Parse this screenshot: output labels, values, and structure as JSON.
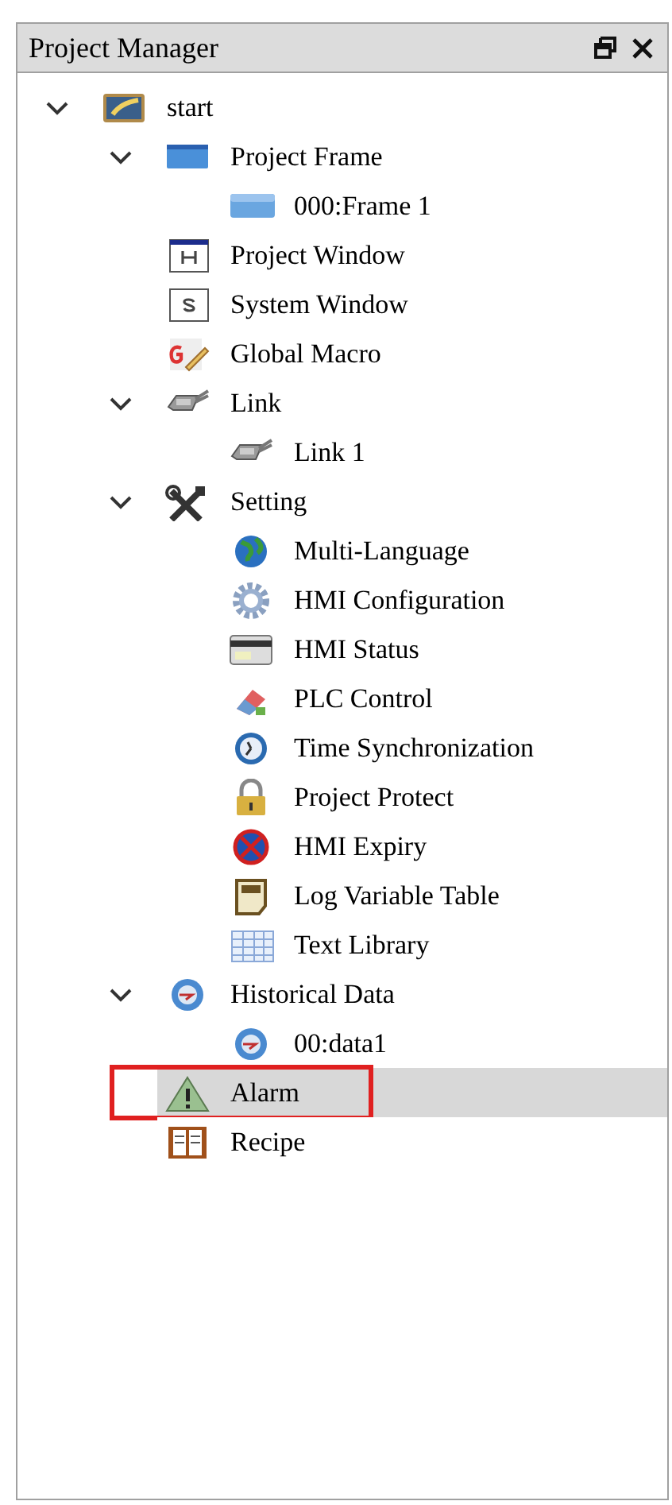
{
  "panel": {
    "title": "Project Manager"
  },
  "tree": [
    {
      "label": "start",
      "kind": "project",
      "expanded": true,
      "selected": false,
      "outlined": false,
      "children": [
        {
          "label": "Project Frame",
          "kind": "frame",
          "expanded": true,
          "selected": false,
          "outlined": false,
          "children": [
            {
              "label": "000:Frame 1",
              "kind": "screen",
              "selected": false,
              "outlined": false
            }
          ]
        },
        {
          "label": "Project Window",
          "kind": "window-h",
          "selected": false,
          "outlined": false
        },
        {
          "label": "System Window",
          "kind": "window-s",
          "selected": false,
          "outlined": false
        },
        {
          "label": "Global Macro",
          "kind": "macro",
          "selected": false,
          "outlined": false
        },
        {
          "label": "Link",
          "kind": "connector",
          "expanded": true,
          "selected": false,
          "outlined": false,
          "children": [
            {
              "label": "Link 1",
              "kind": "connector",
              "selected": false,
              "outlined": false
            }
          ]
        },
        {
          "label": "Setting",
          "kind": "tools",
          "expanded": true,
          "selected": false,
          "outlined": false,
          "children": [
            {
              "label": "Multi-Language",
              "kind": "globe",
              "selected": false,
              "outlined": false
            },
            {
              "label": "HMI Configuration",
              "kind": "gear",
              "selected": false,
              "outlined": false
            },
            {
              "label": "HMI Status",
              "kind": "card",
              "selected": false,
              "outlined": false
            },
            {
              "label": "PLC Control",
              "kind": "eraser",
              "selected": false,
              "outlined": false
            },
            {
              "label": "Time Synchronization",
              "kind": "clock",
              "selected": false,
              "outlined": false
            },
            {
              "label": "Project Protect",
              "kind": "lock",
              "selected": false,
              "outlined": false
            },
            {
              "label": "HMI Expiry",
              "kind": "forbidden",
              "selected": false,
              "outlined": false
            },
            {
              "label": "Log Variable Table",
              "kind": "var",
              "selected": false,
              "outlined": false
            },
            {
              "label": "Text Library",
              "kind": "table",
              "selected": false,
              "outlined": false
            }
          ]
        },
        {
          "label": "Historical Data",
          "kind": "history",
          "expanded": true,
          "selected": false,
          "outlined": false,
          "children": [
            {
              "label": "00:data1",
              "kind": "history",
              "selected": false,
              "outlined": false
            }
          ]
        },
        {
          "label": "Alarm",
          "kind": "warning",
          "selected": true,
          "outlined": true
        },
        {
          "label": "Recipe",
          "kind": "book",
          "selected": false,
          "outlined": false
        }
      ]
    }
  ]
}
